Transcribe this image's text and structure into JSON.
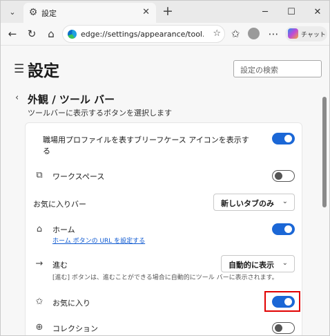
{
  "browser": {
    "tab_title": "設定",
    "url": "edge://settings/appearance/tool...",
    "copilot_label": "チャット",
    "accent": "#1b67d6"
  },
  "page": {
    "title": "設定",
    "search_placeholder": "設定の検索"
  },
  "section": {
    "title": "外観 / ツール バー",
    "subtitle": "ツールバーに表示するボタンを選択します"
  },
  "settings": {
    "briefcase": {
      "label_line1": "職場用プロファイルを表すブリーフケース アイコンを表示す",
      "label_line2": "る",
      "enabled": true
    },
    "workspaces": {
      "label": "ワークスペース",
      "enabled": false
    },
    "favorites_bar": {
      "label": "お気に入りバー",
      "value": "新しいタブのみ"
    },
    "home": {
      "label": "ホーム",
      "link": "ホーム ボタンの URL を設定する",
      "enabled": true
    },
    "forward": {
      "label": "進む",
      "value": "自動的に表示",
      "note": "[進む] ボタンは、進むことができる場合に自動的にツール バーに表示されます。"
    },
    "favorites": {
      "label": "お気に入り",
      "enabled": true
    },
    "collections": {
      "label": "コレクション",
      "enabled": false
    }
  }
}
